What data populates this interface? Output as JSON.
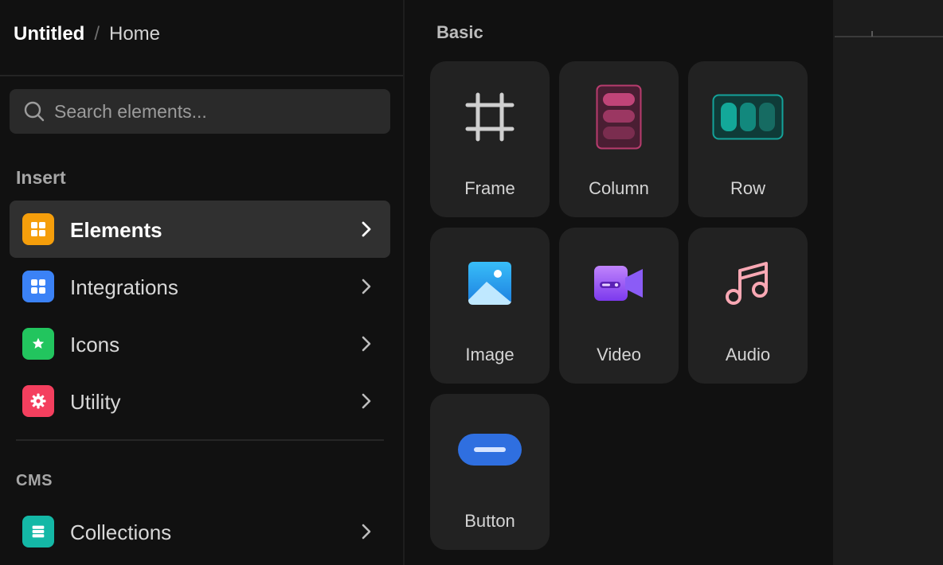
{
  "header": {
    "project": "Untitled",
    "separator": "/",
    "page": "Home"
  },
  "search": {
    "placeholder": "Search elements..."
  },
  "insert": {
    "title": "Insert",
    "items": [
      {
        "label": "Elements",
        "icon": "elements-grid-icon",
        "color": "#f59e0b",
        "active": true
      },
      {
        "label": "Integrations",
        "icon": "integrations-grid-icon",
        "color": "#3b82f6",
        "active": false
      },
      {
        "label": "Icons",
        "icon": "star-icon",
        "color": "#22c55e",
        "active": false
      },
      {
        "label": "Utility",
        "icon": "gear-icon",
        "color": "#f43f5e",
        "active": false
      }
    ]
  },
  "cms": {
    "title": "CMS",
    "items": [
      {
        "label": "Collections",
        "icon": "collections-icon",
        "color": "#14b8a6"
      }
    ]
  },
  "basic": {
    "title": "Basic",
    "tiles": [
      {
        "label": "Frame",
        "icon": "frame-icon"
      },
      {
        "label": "Column",
        "icon": "column-icon",
        "color": "#b83c6e"
      },
      {
        "label": "Row",
        "icon": "row-icon",
        "color": "#0d9488"
      },
      {
        "label": "Image",
        "icon": "image-icon",
        "color": "#38bdf8"
      },
      {
        "label": "Video",
        "icon": "video-icon",
        "color": "#8b5cf6"
      },
      {
        "label": "Audio",
        "icon": "music-note-icon",
        "color": "#f9a8b4"
      },
      {
        "label": "Button",
        "icon": "button-icon",
        "color": "#2f6fe0"
      }
    ]
  }
}
